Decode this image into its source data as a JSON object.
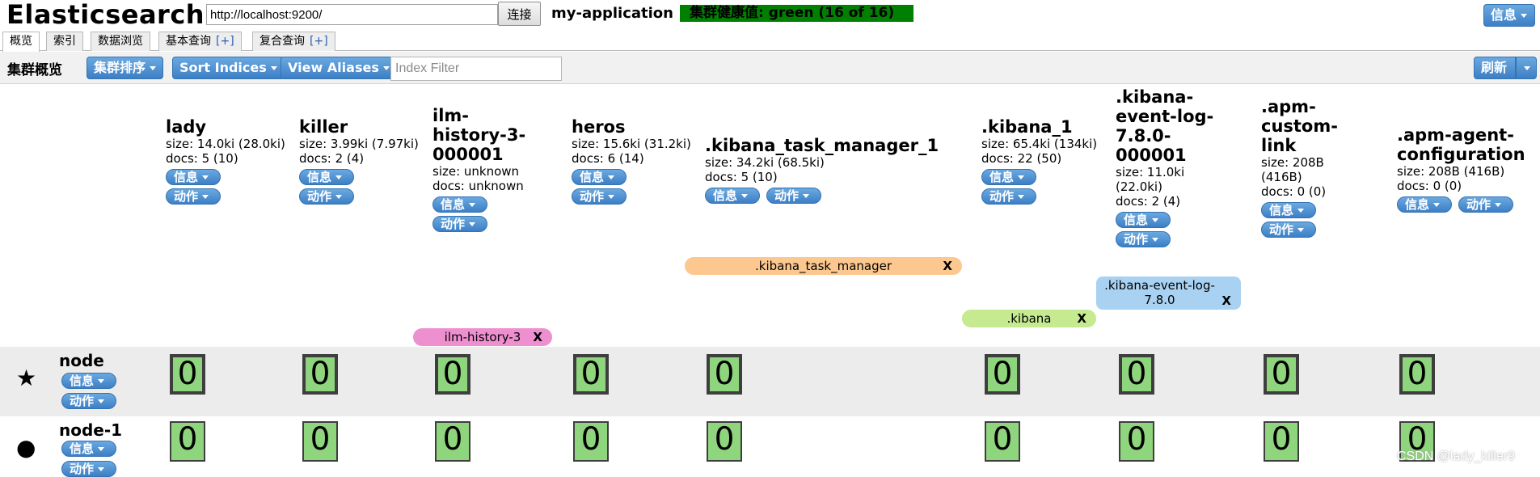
{
  "header": {
    "app_title": "Elasticsearch",
    "url_value": "http://localhost:9200/",
    "connect_label": "连接",
    "cluster_name": "my-application",
    "health_text": "集群健康值: green (16 of 16)",
    "health_color": "#008000",
    "info_label": "信息"
  },
  "tabs": [
    {
      "label": "概览",
      "active": true
    },
    {
      "label": "索引"
    },
    {
      "label": "数据浏览"
    },
    {
      "label": "基本查询",
      "plus": "[+]"
    },
    {
      "label": "复合查询",
      "plus": "[+]"
    }
  ],
  "toolbar": {
    "title": "集群概览",
    "sort_cluster": "集群排序",
    "sort_indices": "Sort Indices",
    "view_aliases": "View Aliases",
    "index_filter_placeholder": "Index Filter",
    "refresh": "刷新"
  },
  "pill_labels": {
    "info": "信息",
    "action": "动作"
  },
  "indices": [
    {
      "name": "lady",
      "size": "size: 14.0ki (28.0ki)",
      "docs": "docs: 5 (10)"
    },
    {
      "name": "killer",
      "size": "size: 3.99ki (7.97ki)",
      "docs": "docs: 2 (4)"
    },
    {
      "name": "ilm-history-3-000001",
      "size": "size: unknown",
      "docs": "docs: unknown"
    },
    {
      "name": "heros",
      "size": "size: 15.6ki (31.2ki)",
      "docs": "docs: 6 (14)"
    },
    {
      "name": ".kibana_task_manager_1",
      "size": "size: 34.2ki (68.5ki)",
      "docs": "docs: 5 (10)"
    },
    {
      "name": ".kibana_1",
      "size": "size: 65.4ki (134ki)",
      "docs": "docs: 22 (50)"
    },
    {
      "name": ".kibana-event-log-7.8.0-000001",
      "size": "size: 11.0ki (22.0ki)",
      "docs": "docs: 2 (4)"
    },
    {
      "name": ".apm-custom-link",
      "size": "size: 208B (416B)",
      "docs": "docs: 0 (0)"
    },
    {
      "name": ".apm-agent-configuration",
      "size": "size: 208B (416B)",
      "docs": "docs: 0 (0)"
    }
  ],
  "aliases": [
    {
      "name": ".kibana_task_manager",
      "x": "X",
      "color": "#fcc88f"
    },
    {
      "name": "ilm-history-3",
      "x": "X",
      "color": "#ee8fcf"
    },
    {
      "name": ".kibana",
      "x": "X",
      "color": "#c5ea8f"
    },
    {
      "name": ".kibana-event-log-7.8.0",
      "x": "X",
      "color": "#a9d2f2"
    }
  ],
  "nodes": [
    {
      "name": "node",
      "icon": "star-icon",
      "glyph": "★",
      "shards": [
        "0",
        "0",
        "0",
        "0",
        "0",
        "0",
        "0",
        "0",
        "0"
      ]
    },
    {
      "name": "node-1",
      "icon": "circle-icon",
      "glyph": "●",
      "shards": [
        "0",
        "0",
        "0",
        "0",
        "0",
        "0",
        "0",
        "0",
        "0"
      ]
    }
  ],
  "shard_color": "#8fd57d",
  "watermark": "CSDN @lady_killer9"
}
